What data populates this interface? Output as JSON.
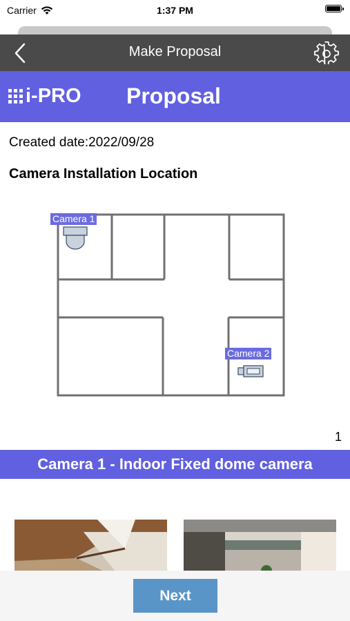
{
  "status_bar": {
    "carrier": "Carrier",
    "time": "1:37 PM",
    "wifi_icon": "wifi-icon",
    "battery_icon": "battery-icon"
  },
  "navbar": {
    "title": "Make Proposal",
    "back_icon": "chevron-left-icon",
    "settings_icon": "gear-icon"
  },
  "banner": {
    "logo": "i-PRO",
    "title": "Proposal"
  },
  "created_date": "Created date:2022/09/28",
  "section_title": "Camera Installation Location",
  "floorplan": {
    "cameras": [
      {
        "label": "Camera 1",
        "icon": "dome-camera-icon"
      },
      {
        "label": "Camera 2",
        "icon": "box-camera-icon"
      }
    ]
  },
  "page_number": "1",
  "camera_heading": "Camera 1 - Indoor Fixed dome camera",
  "footer": {
    "next_label": "Next"
  },
  "colors": {
    "accent": "#6060e0",
    "navbar": "#4a4a4a",
    "button": "#5a95c8"
  }
}
